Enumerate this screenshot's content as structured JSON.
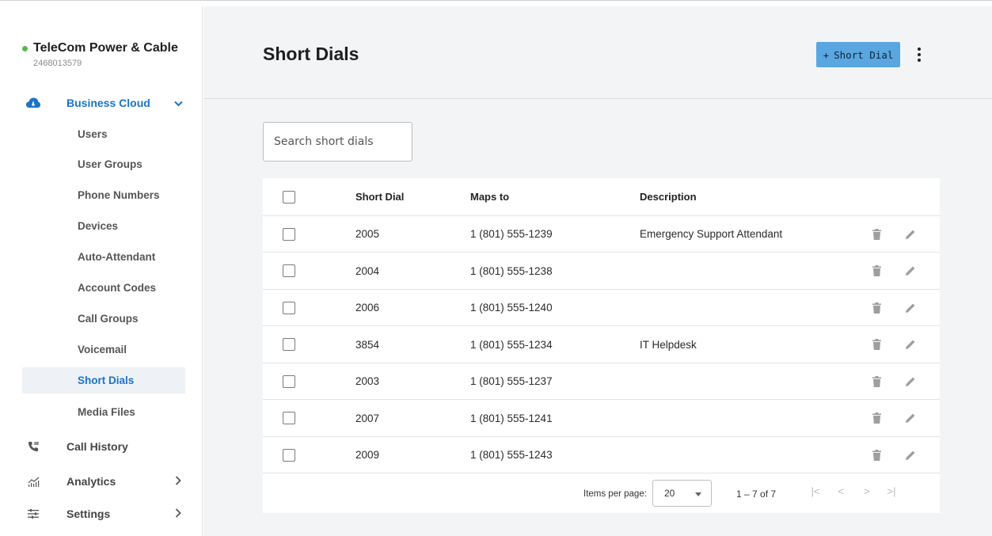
{
  "org": {
    "name": "TeleCom Power & Cable",
    "id": "2468013579",
    "status_color": "#56b94b"
  },
  "sidebar": {
    "group": {
      "label": "Business Cloud",
      "icon": "cloud-phone-icon",
      "expanded": true
    },
    "sub_items": [
      {
        "label": "Users"
      },
      {
        "label": "User Groups"
      },
      {
        "label": "Phone Numbers"
      },
      {
        "label": "Devices"
      },
      {
        "label": "Auto-Attendant"
      },
      {
        "label": "Account Codes"
      },
      {
        "label": "Call Groups"
      },
      {
        "label": "Voicemail"
      },
      {
        "label": "Short Dials",
        "active": true
      },
      {
        "label": "Media Files"
      }
    ],
    "main_items": [
      {
        "label": "Call History",
        "icon": "call-history-icon"
      },
      {
        "label": "Analytics",
        "icon": "analytics-icon"
      },
      {
        "label": "Settings",
        "icon": "settings-sliders-icon"
      }
    ]
  },
  "header": {
    "title": "Short Dials",
    "add_label": "Short Dial"
  },
  "search": {
    "placeholder": "Search short dials",
    "value": ""
  },
  "table": {
    "columns": [
      "Short Dial",
      "Maps to",
      "Description"
    ],
    "rows": [
      {
        "short_dial": "2005",
        "maps_to": "1 (801) 555-1239",
        "description": "Emergency Support Attendant"
      },
      {
        "short_dial": "2004",
        "maps_to": "1 (801) 555-1238",
        "description": ""
      },
      {
        "short_dial": "2006",
        "maps_to": "1 (801) 555-1240",
        "description": ""
      },
      {
        "short_dial": "3854",
        "maps_to": "1 (801) 555-1234",
        "description": "IT Helpdesk"
      },
      {
        "short_dial": "2003",
        "maps_to": "1 (801) 555-1237",
        "description": ""
      },
      {
        "short_dial": "2007",
        "maps_to": "1 (801) 555-1241",
        "description": ""
      },
      {
        "short_dial": "2009",
        "maps_to": "1 (801) 555-1243",
        "description": ""
      }
    ]
  },
  "pagination": {
    "items_per_page_label": "Items per page:",
    "page_size": "20",
    "range": "1 – 7 of 7"
  },
  "colors": {
    "accent": "#1a73c9",
    "button": "#5aa6e0",
    "active_bg": "#eef2f6",
    "main_bg": "#f3f4f6"
  }
}
